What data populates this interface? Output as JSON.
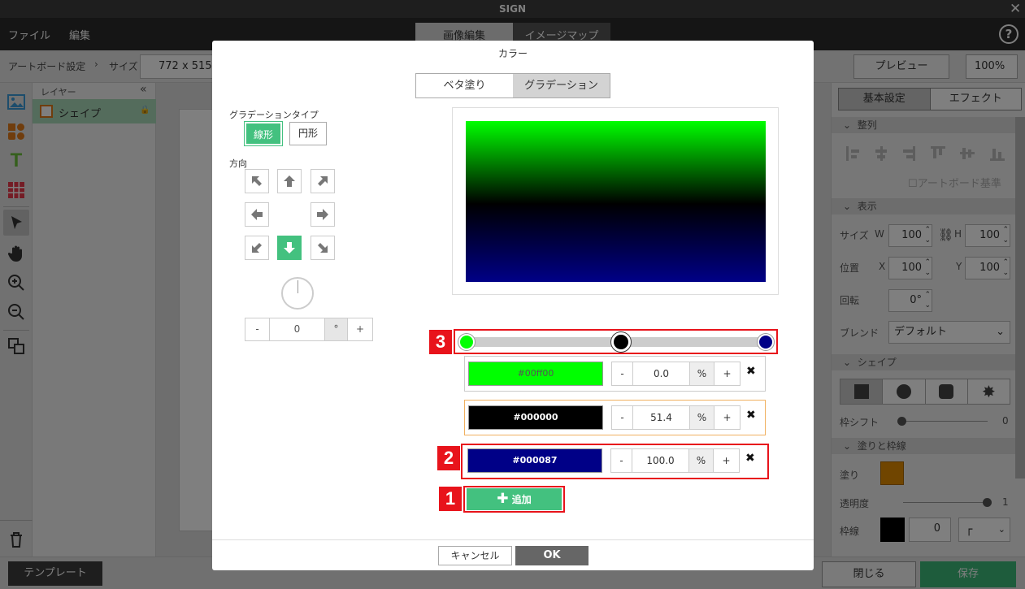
{
  "app": {
    "title": "SIGN"
  },
  "menu": {
    "file": "ファイル",
    "edit": "編集",
    "tabs": [
      "画像編集",
      "イメージマップ"
    ]
  },
  "topbar": {
    "artboard_settings": "アートボード設定",
    "size_label": "サイズ",
    "size_value": "772 x 515",
    "preview": "プレビュー",
    "zoom": "100%"
  },
  "layers": {
    "header": "レイヤー",
    "items": [
      {
        "label": "シェイプ"
      }
    ]
  },
  "right_panel": {
    "tabs": [
      "基本設定",
      "エフェクト"
    ],
    "align_section": "整列",
    "artboard_base": "アートボード基準",
    "display_section": "表示",
    "size_label": "サイズ",
    "w_label": "W",
    "w_value": "100",
    "h_label": "H",
    "h_value": "100",
    "position_label": "位置",
    "x_label": "X",
    "x_value": "100",
    "y_label": "Y",
    "y_value": "100",
    "rotation_label": "回転",
    "rotation_value": "0°",
    "blend_label": "ブレンド",
    "blend_value": "デフォルト",
    "shape_section": "シェイプ",
    "border_shift_label": "枠シフト",
    "border_shift_value": "0",
    "fill_section": "塗りと枠線",
    "fill_label": "塗り",
    "fill_color": "#e08a00",
    "opacity_label": "透明度",
    "opacity_value": "1",
    "stroke_label": "枠線",
    "stroke_value": "0"
  },
  "bottom": {
    "template": "テンプレート",
    "close": "閉じる",
    "save": "保存"
  },
  "dialog": {
    "title": "カラー",
    "mode_tabs": [
      "ベタ塗り",
      "グラデーション"
    ],
    "gradient_type_label": "グラデーションタイプ",
    "linear": "線形",
    "radial": "円形",
    "direction_label": "方向",
    "angle_minus": "-",
    "angle_value": "0",
    "angle_unit": "°",
    "angle_plus": "+",
    "stops": [
      {
        "hex": "#00ff00",
        "label": "#00ff00",
        "position": "0.0",
        "percent": "%",
        "minus": "-",
        "plus": "+"
      },
      {
        "hex": "#000000",
        "label": "#000000",
        "position": "51.4",
        "percent": "%",
        "minus": "-",
        "plus": "+"
      },
      {
        "hex": "#000087",
        "label": "#000087",
        "position": "100.0",
        "percent": "%",
        "minus": "-",
        "plus": "+"
      }
    ],
    "add_label": "追加",
    "cancel": "キャンセル",
    "ok": "OK",
    "badges": [
      "1",
      "2",
      "3"
    ]
  },
  "colors": {
    "accent": "#43c17f",
    "save": "#3cb878",
    "annotation": "#e8131b"
  }
}
